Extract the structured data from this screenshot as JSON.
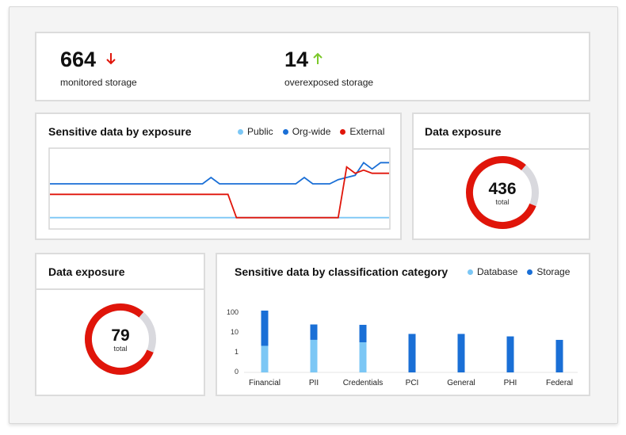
{
  "summary": {
    "monitored": {
      "value": "664",
      "label": "monitored storage",
      "trend": "down"
    },
    "overexposed": {
      "value": "14",
      "label": "overexposed storage",
      "trend": "up"
    }
  },
  "line_card": {
    "title": "Sensitive data by exposure",
    "legend": [
      {
        "label": "Public",
        "color": "#7cc7f5"
      },
      {
        "label": "Org-wide",
        "color": "#1a6fd6"
      },
      {
        "label": "External",
        "color": "#e0150a"
      }
    ]
  },
  "donut_right": {
    "title": "Data exposure",
    "value": "436",
    "label": "total",
    "fraction": 0.8,
    "color": "#e0150a",
    "track": "#d9d9de"
  },
  "donut_left": {
    "title": "Data exposure",
    "value": "79",
    "label": "total",
    "fraction": 0.8,
    "color": "#e0150a",
    "track": "#d9d9de"
  },
  "bar_card": {
    "title": "Sensitive data by classification category",
    "legend": [
      {
        "label": "Database",
        "color": "#7cc7f5"
      },
      {
        "label": "Storage",
        "color": "#1a6fd6"
      }
    ]
  },
  "chart_data": [
    {
      "type": "line",
      "x": [
        0,
        1,
        2,
        3,
        4,
        5,
        6,
        7,
        8,
        9,
        10,
        11,
        12,
        13,
        14,
        15,
        16,
        17,
        18,
        19,
        20,
        21,
        22,
        23,
        24,
        25,
        26,
        27,
        28,
        29,
        30,
        31,
        32,
        33,
        34,
        35,
        36,
        37,
        38,
        39,
        40
      ],
      "series": [
        {
          "name": "Public",
          "values": [
            1,
            1,
            1,
            1,
            1,
            1,
            1,
            1,
            1,
            1,
            1,
            1,
            1,
            1,
            1,
            1,
            1,
            1,
            1,
            1,
            1,
            1,
            1,
            1,
            1,
            1,
            1,
            1,
            1,
            1,
            1,
            1,
            1,
            1,
            1,
            1,
            1,
            1,
            1,
            1,
            1
          ]
        },
        {
          "name": "Org-wide",
          "values": [
            4.2,
            4.2,
            4.2,
            4.2,
            4.2,
            4.2,
            4.2,
            4.2,
            4.2,
            4.2,
            4.2,
            4.2,
            4.2,
            4.2,
            4.2,
            4.2,
            4.2,
            4.2,
            4.2,
            4.8,
            4.2,
            4.2,
            4.2,
            4.2,
            4.2,
            4.2,
            4.2,
            4.2,
            4.2,
            4.2,
            4.8,
            4.2,
            4.2,
            4.2,
            4.6,
            4.8,
            5.0,
            6.2,
            5.6,
            6.2,
            6.2
          ]
        },
        {
          "name": "External",
          "values": [
            3.2,
            3.2,
            3.2,
            3.2,
            3.2,
            3.2,
            3.2,
            3.2,
            3.2,
            3.2,
            3.2,
            3.2,
            3.2,
            3.2,
            3.2,
            3.2,
            3.2,
            3.2,
            3.2,
            3.2,
            3.2,
            3.2,
            1,
            1,
            1,
            1,
            1,
            1,
            1,
            1,
            1,
            1,
            1,
            1,
            1,
            5.8,
            5.2,
            5.5,
            5.2,
            5.2,
            5.2
          ]
        }
      ],
      "ylim": [
        0,
        7.5
      ],
      "grid": false
    },
    {
      "type": "bar",
      "categories": [
        "Financial",
        "PII",
        "Credentials",
        "PCI",
        "General",
        "PHI",
        "Federal"
      ],
      "series": [
        {
          "name": "Database",
          "values": [
            2,
            4,
            3,
            0,
            0,
            0,
            0
          ]
        },
        {
          "name": "Storage",
          "values": [
            150,
            20,
            20,
            8,
            8,
            6,
            4
          ]
        }
      ],
      "yticks": [
        "100",
        "10",
        "1",
        "0"
      ],
      "scale": "log"
    }
  ]
}
